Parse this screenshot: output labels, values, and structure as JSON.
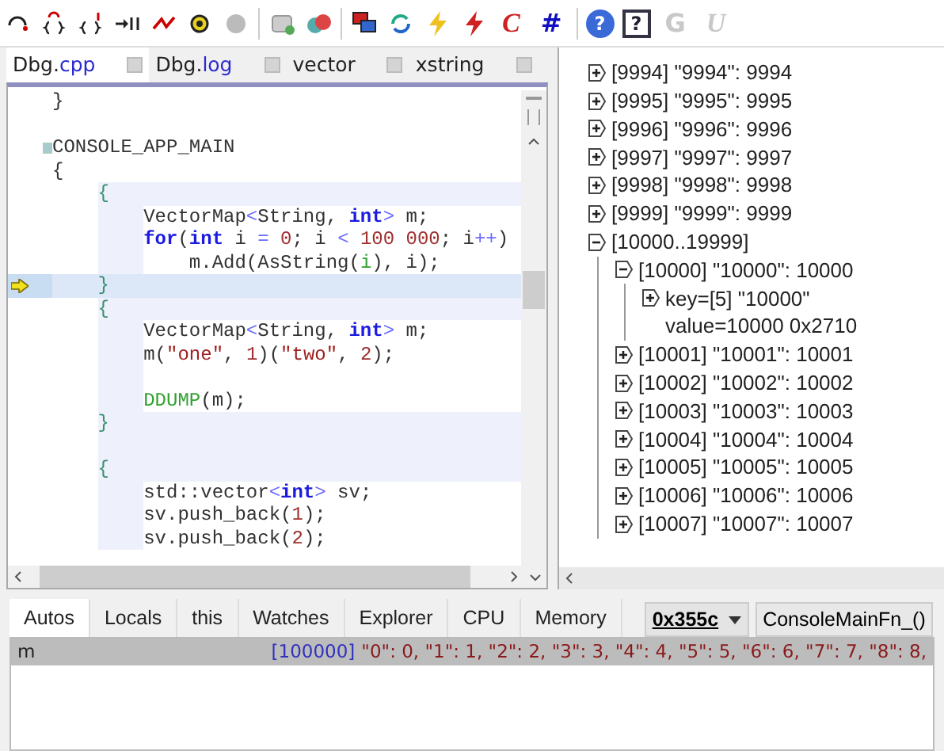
{
  "toolbar": {
    "glyphs": [
      {
        "kind": "italic",
        "text": "C",
        "disabled": false
      },
      {
        "kind": "bold",
        "text": "#",
        "disabled": false
      },
      {
        "kind": "circle",
        "text": "?",
        "disabled": false
      },
      {
        "kind": "boxed",
        "text": "?",
        "disabled": false
      },
      {
        "kind": "bold",
        "text": "G",
        "disabled": true
      },
      {
        "kind": "italic",
        "text": "U",
        "disabled": true
      }
    ]
  },
  "editor_tabs": [
    {
      "name": "Dbg.",
      "ext": "cpp",
      "selected": true
    },
    {
      "name": "Dbg.",
      "ext": "log",
      "selected": false
    },
    {
      "name": "vector",
      "selected": false
    },
    {
      "name": "xstring",
      "selected": false
    }
  ],
  "code": [
    {
      "kind": "plain",
      "current": false,
      "bookmark": false,
      "tokens": [
        {
          "kind": "plain",
          "text": "}"
        }
      ]
    },
    {
      "kind": "plain",
      "current": false,
      "bookmark": false
    },
    {
      "kind": "plain",
      "current": false,
      "bookmark": true,
      "tokens": [
        {
          "kind": "plain",
          "text": "CONSOLE_APP_MAIN"
        }
      ]
    },
    {
      "kind": "plain",
      "current": false,
      "bookmark": false,
      "tokens": [
        {
          "kind": "plain",
          "text": "{"
        }
      ]
    },
    {
      "kind": "block",
      "current": false,
      "bookmark": false,
      "tokens": [
        {
          "kind": "brace",
          "text": "    {"
        }
      ]
    },
    {
      "kind": "block-body",
      "current": false,
      "bookmark": false,
      "tokens": [
        {
          "kind": "plain",
          "text": "        VectorMap"
        },
        {
          "kind": "op",
          "text": "<"
        },
        {
          "kind": "plain",
          "text": "String, "
        },
        {
          "kind": "kw",
          "text": "int"
        },
        {
          "kind": "op",
          "text": ">"
        },
        {
          "kind": "plain",
          "text": " m;"
        }
      ]
    },
    {
      "kind": "block-body",
      "current": false,
      "bookmark": false,
      "tokens": [
        {
          "kind": "kw",
          "text": "        for"
        },
        {
          "kind": "plain",
          "text": "("
        },
        {
          "kind": "kw",
          "text": "int"
        },
        {
          "kind": "plain",
          "text": " i "
        },
        {
          "kind": "op",
          "text": "="
        },
        {
          "kind": "num",
          "text": " 0"
        },
        {
          "kind": "plain",
          "text": "; i "
        },
        {
          "kind": "op",
          "text": "<"
        },
        {
          "kind": "num",
          "text": " 100 000"
        },
        {
          "kind": "plain",
          "text": "; i"
        },
        {
          "kind": "op",
          "text": "++"
        },
        {
          "kind": "plain",
          "text": ")"
        }
      ]
    },
    {
      "kind": "block-body",
      "current": false,
      "bookmark": false,
      "tokens": [
        {
          "kind": "plain",
          "text": "            m.Add(AsString("
        },
        {
          "kind": "macro",
          "text": "i"
        },
        {
          "kind": "plain",
          "text": "), i);"
        }
      ]
    },
    {
      "kind": "block",
      "current": true,
      "bookmark": false,
      "tokens": [
        {
          "kind": "brace",
          "text": "    }"
        }
      ]
    },
    {
      "kind": "block",
      "current": false,
      "bookmark": false,
      "tokens": [
        {
          "kind": "brace",
          "text": "    {"
        }
      ]
    },
    {
      "kind": "block-body",
      "current": false,
      "bookmark": false,
      "tokens": [
        {
          "kind": "plain",
          "text": "        VectorMap"
        },
        {
          "kind": "op",
          "text": "<"
        },
        {
          "kind": "plain",
          "text": "String, "
        },
        {
          "kind": "kw",
          "text": "int"
        },
        {
          "kind": "op",
          "text": ">"
        },
        {
          "kind": "plain",
          "text": " m;"
        }
      ]
    },
    {
      "kind": "block-body",
      "current": false,
      "bookmark": false,
      "tokens": [
        {
          "kind": "plain",
          "text": "        m("
        },
        {
          "kind": "str",
          "text": "\"one\""
        },
        {
          "kind": "plain",
          "text": ", "
        },
        {
          "kind": "num",
          "text": "1"
        },
        {
          "kind": "plain",
          "text": ")("
        },
        {
          "kind": "str",
          "text": "\"two\""
        },
        {
          "kind": "plain",
          "text": ", "
        },
        {
          "kind": "num",
          "text": "2"
        },
        {
          "kind": "plain",
          "text": ");"
        }
      ]
    },
    {
      "kind": "block-body",
      "current": false,
      "bookmark": false
    },
    {
      "kind": "block-body",
      "current": false,
      "bookmark": false,
      "tokens": [
        {
          "kind": "macro",
          "text": "        DDUMP"
        },
        {
          "kind": "plain",
          "text": "(m);"
        }
      ]
    },
    {
      "kind": "block",
      "current": false,
      "bookmark": false,
      "tokens": [
        {
          "kind": "brace",
          "text": "    }"
        }
      ]
    },
    {
      "kind": "block",
      "current": false,
      "bookmark": false
    },
    {
      "kind": "block",
      "current": false,
      "bookmark": false,
      "tokens": [
        {
          "kind": "brace",
          "text": "    {"
        }
      ]
    },
    {
      "kind": "block-body",
      "current": false,
      "bookmark": false,
      "tokens": [
        {
          "kind": "plain",
          "text": "        std::vector"
        },
        {
          "kind": "op",
          "text": "<"
        },
        {
          "kind": "kw",
          "text": "int"
        },
        {
          "kind": "op",
          "text": ">"
        },
        {
          "kind": "plain",
          "text": " sv;"
        }
      ]
    },
    {
      "kind": "block-body",
      "current": false,
      "bookmark": false,
      "tokens": [
        {
          "kind": "plain",
          "text": "        sv.push_back("
        },
        {
          "kind": "num",
          "text": "1"
        },
        {
          "kind": "plain",
          "text": ");"
        }
      ]
    },
    {
      "kind": "block-body",
      "current": false,
      "bookmark": false,
      "tokens": [
        {
          "kind": "plain",
          "text": "        sv.push_back("
        },
        {
          "kind": "num",
          "text": "2"
        },
        {
          "kind": "plain",
          "text": ");"
        }
      ]
    }
  ],
  "tree": [
    {
      "label": "[9994] \"9994\": 9994",
      "kind": "node",
      "expanded": false
    },
    {
      "label": "[9995] \"9995\": 9995",
      "kind": "node",
      "expanded": false
    },
    {
      "label": "[9996] \"9996\": 9996",
      "kind": "node",
      "expanded": false
    },
    {
      "label": "[9997] \"9997\": 9997",
      "kind": "node",
      "expanded": false
    },
    {
      "label": "[9998] \"9998\": 9998",
      "kind": "node",
      "expanded": false
    },
    {
      "label": "[9999] \"9999\": 9999",
      "kind": "node",
      "expanded": false
    },
    {
      "label": "[10000..19999]",
      "kind": "node",
      "expanded": true,
      "children": [
        {
          "label": "[10000] \"10000\": 10000",
          "kind": "node",
          "expanded": true,
          "children": [
            {
              "label": "key=[5] \"10000\"",
              "kind": "node",
              "expanded": false
            },
            {
              "label": "value=10000 0x2710",
              "kind": "leaf"
            }
          ]
        },
        {
          "label": "[10001] \"10001\": 10001",
          "kind": "node",
          "expanded": false
        },
        {
          "label": "[10002] \"10002\": 10002",
          "kind": "node",
          "expanded": false
        },
        {
          "label": "[10003] \"10003\": 10003",
          "kind": "node",
          "expanded": false
        },
        {
          "label": "[10004] \"10004\": 10004",
          "kind": "node",
          "expanded": false
        },
        {
          "label": "[10005] \"10005\": 10005",
          "kind": "node",
          "expanded": false
        },
        {
          "label": "[10006] \"10006\": 10006",
          "kind": "node",
          "expanded": false
        },
        {
          "label": "[10007] \"10007\": 10007",
          "kind": "node",
          "expanded": false
        }
      ]
    }
  ],
  "debug_tabs": [
    {
      "label": "Autos",
      "selected": true
    },
    {
      "label": "Locals",
      "selected": false
    },
    {
      "label": "this",
      "selected": false
    },
    {
      "label": "Watches",
      "selected": false
    },
    {
      "label": "Explorer",
      "selected": false
    },
    {
      "label": "CPU",
      "selected": false
    },
    {
      "label": "Memory",
      "selected": false
    }
  ],
  "thread": {
    "value": "0x355c"
  },
  "frame": {
    "value": "ConsoleMainFn_()"
  },
  "variables": [
    {
      "name": "m",
      "selected": true,
      "count": "[100000]",
      "value": "\"0\": 0, \"1\": 1, \"2\": 2, \"3\": 3, \"4\": 4, \"5\": 5, \"6\": 6, \"7\": 7, \"8\": 8,"
    }
  ]
}
